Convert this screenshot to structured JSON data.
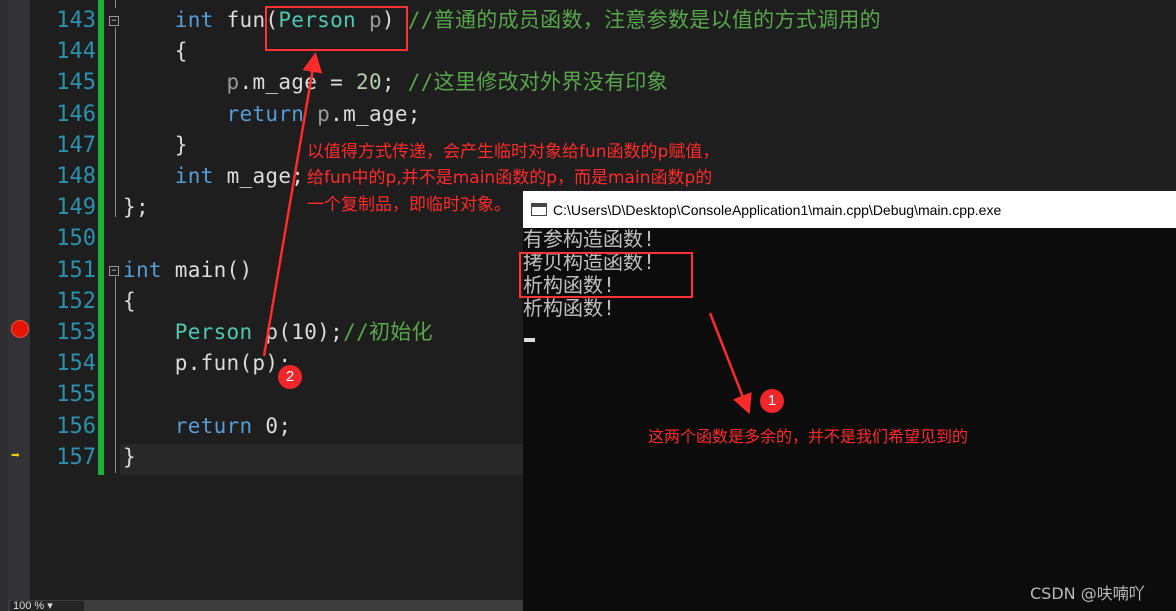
{
  "editor": {
    "lines": [
      {
        "n": "143",
        "parts": [
          [
            "    ",
            ""
          ],
          [
            "int",
            "kw"
          ],
          [
            " fun(",
            ""
          ],
          [
            "Person",
            "ty"
          ],
          [
            " p",
            "pa"
          ],
          [
            ") ",
            ""
          ],
          [
            "//普通的成员函数，注意参数是以值的方式调用的",
            "cm"
          ]
        ]
      },
      {
        "n": "144",
        "parts": [
          [
            "    {",
            ""
          ]
        ]
      },
      {
        "n": "145",
        "parts": [
          [
            "        ",
            ""
          ],
          [
            "p",
            "pa"
          ],
          [
            ".m_age = ",
            ""
          ],
          [
            "20",
            "nu"
          ],
          [
            "; ",
            ""
          ],
          [
            "//这里修改对外界没有印象",
            "cm"
          ]
        ]
      },
      {
        "n": "146",
        "parts": [
          [
            "        ",
            ""
          ],
          [
            "return",
            "kw"
          ],
          [
            " ",
            ""
          ],
          [
            "p",
            "pa"
          ],
          [
            ".m_age;",
            ""
          ]
        ]
      },
      {
        "n": "147",
        "parts": [
          [
            "    }",
            ""
          ]
        ]
      },
      {
        "n": "148",
        "parts": [
          [
            "    ",
            ""
          ],
          [
            "int",
            "kw"
          ],
          [
            " m_age;",
            ""
          ]
        ]
      },
      {
        "n": "149",
        "parts": [
          [
            "};",
            ""
          ]
        ]
      },
      {
        "n": "150",
        "parts": []
      },
      {
        "n": "151",
        "parts": [
          [
            "int",
            "kw"
          ],
          [
            " main()",
            ""
          ]
        ]
      },
      {
        "n": "152",
        "parts": [
          [
            "{",
            ""
          ]
        ]
      },
      {
        "n": "153",
        "parts": [
          [
            "    ",
            ""
          ],
          [
            "Person",
            "ty"
          ],
          [
            " p(10);",
            ""
          ],
          [
            "//初始化",
            "cm"
          ]
        ]
      },
      {
        "n": "154",
        "parts": [
          [
            "    p.fun(p);",
            ""
          ]
        ]
      },
      {
        "n": "155",
        "parts": []
      },
      {
        "n": "156",
        "parts": [
          [
            "    ",
            ""
          ],
          [
            "return",
            "kw"
          ],
          [
            " 0;",
            ""
          ]
        ]
      },
      {
        "n": "157",
        "parts": [
          [
            "}",
            ""
          ]
        ]
      }
    ],
    "zoom": "100 %",
    "breakpoint_line": "153",
    "current_line": "157"
  },
  "console": {
    "title": "C:\\Users\\D\\Desktop\\ConsoleApplication1\\main.cpp\\Debug\\main.cpp.exe",
    "output": [
      "有参构造函数!",
      "拷贝构造函数!",
      "析构函数!",
      "析构函数!"
    ]
  },
  "annotations": {
    "note2": [
      "以值得方式传递，会产生临时对象给fun函数的p赋值，",
      "给fun中的p,并不是main函数的p，而是main函数p的",
      "一个复制品，即临时对象。"
    ],
    "note1": "这两个函数是多余的，并不是我们希望见到的",
    "badge1": "1",
    "badge2": "2",
    "color": "#ff2a2a"
  },
  "watermark": "CSDN @呋喃吖"
}
